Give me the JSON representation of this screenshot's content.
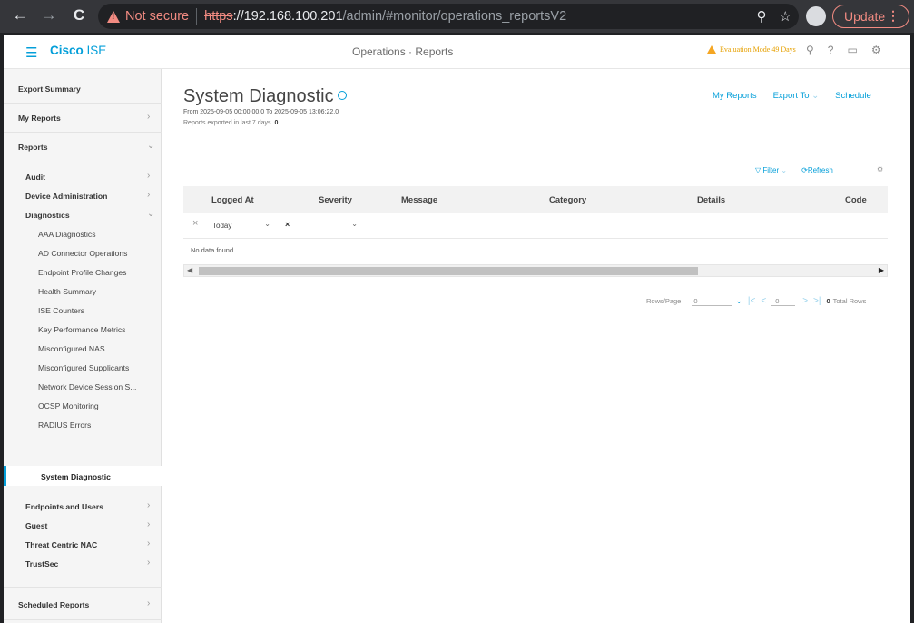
{
  "browser": {
    "back": "←",
    "forward": "→",
    "reload": "C",
    "security_label": "Not secure",
    "url_scheme": "https",
    "url_host": "://192.168.100.201",
    "url_path": "/admin/#monitor/operations_reportsV2",
    "zoom_icon": "⚲",
    "star_icon": "☆",
    "update_label": "Update",
    "menu_icon": "⋮"
  },
  "app": {
    "brand_bold": "Cisco",
    "brand_rest": " ISE",
    "breadcrumb": "Operations · Reports",
    "evaluation": "Evaluation Mode 49 Days",
    "icons": [
      "⚲",
      "?",
      "▭",
      "⚙"
    ]
  },
  "sidebar": {
    "export_summary": "Export Summary",
    "my_reports": "My Reports",
    "reports": "Reports",
    "audit": "Audit",
    "device_admin": "Device Administration",
    "diagnostics": "Diagnostics",
    "diagnostics_items": [
      "AAA Diagnostics",
      "AD Connector Operations",
      "Endpoint Profile Changes",
      "Health Summary",
      "ISE Counters",
      "Key Performance Metrics",
      "Misconfigured NAS",
      "Misconfigured Supplicants",
      "Network Device Session S...",
      "OCSP Monitoring",
      "RADIUS Errors",
      "System Diagnostic"
    ],
    "endpoints_users": "Endpoints and Users",
    "guest": "Guest",
    "threat_nac": "Threat Centric NAC",
    "trustsec": "TrustSec",
    "scheduled": "Scheduled Reports"
  },
  "main": {
    "title": "System Diagnostic",
    "range": "From 2025-09-05 00:00:00.0 To 2025-09-05 13:06:22.0",
    "exported_label": "Reports exported in last 7 days",
    "exported_count": "0",
    "actions": {
      "my_reports": "My Reports",
      "export_to": "Export To",
      "schedule": "Schedule"
    },
    "filter": "Filter",
    "refresh": "Refresh",
    "columns": [
      "Logged At",
      "Severity",
      "Message",
      "Category",
      "Details",
      "Code"
    ],
    "filter_logged_at": "Today",
    "no_data": "No data found.",
    "pager": {
      "rows_label": "Rows/Page",
      "rows_value": "0",
      "page_value": "0",
      "total_count": "0",
      "total_label": "Total Rows"
    }
  }
}
